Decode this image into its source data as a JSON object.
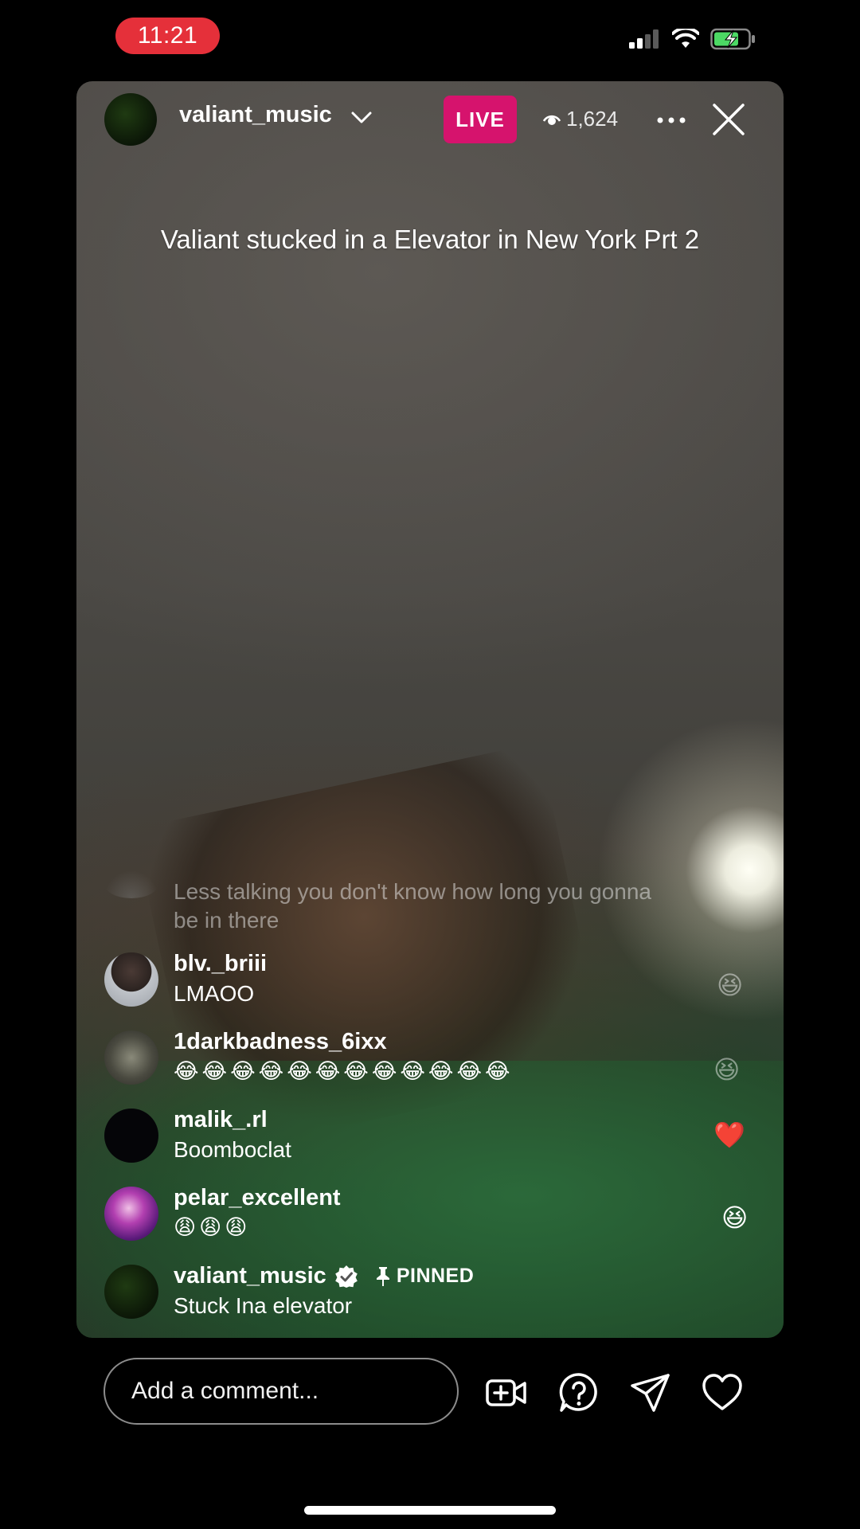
{
  "status_bar": {
    "time": "11:21",
    "icons": [
      "signal-icon",
      "wifi-icon",
      "battery-charging-icon"
    ],
    "time_pill_color": "#e5303a"
  },
  "header": {
    "host_username": "valiant_music",
    "live_label": "LIVE",
    "live_color": "#d6136d",
    "viewer_count": "1,624",
    "icons": [
      "chevron-down-icon",
      "eye-icon",
      "more-icon",
      "close-icon"
    ]
  },
  "stream_title": "Valiant stucked in a Elevator in New York Prt 2",
  "comments": [
    {
      "username": "",
      "text": "Less talking you don't know how long you gonna be in there",
      "faded": true,
      "reaction": ""
    },
    {
      "username": "blv._briii",
      "text": "LMAOO",
      "reaction": "😆"
    },
    {
      "username": "1darkbadness_6ixx",
      "text": "😂😂😂😂😂😂😂😂😂😂😂😂",
      "reaction": "😆"
    },
    {
      "username": "malik_.rl",
      "text": "Boomboclat",
      "reaction": "❤️"
    },
    {
      "username": "pelar_excellent",
      "text": "😩😩😩",
      "reaction": "😆"
    },
    {
      "username": "valiant_music",
      "text": "Stuck Ina elevator",
      "verified": true,
      "pinned_label": "PINNED"
    }
  ],
  "bottom_bar": {
    "comment_placeholder": "Add a comment...",
    "icons": [
      "add-video-icon",
      "question-icon",
      "share-icon",
      "heart-icon"
    ]
  }
}
